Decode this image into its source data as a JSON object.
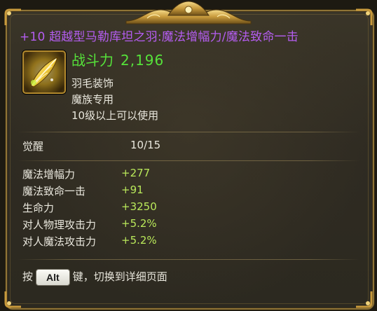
{
  "tooltip": {
    "title": "+10 超越型马勒库坦之羽:魔法增幅力/魔法致命一击",
    "combat_power_label": "战斗力",
    "combat_power_value": "2,196",
    "item_type": "羽毛装饰",
    "race_restriction": "魔族专用",
    "level_requirement": "10级以上可以使用",
    "awakening": {
      "label": "觉醒",
      "value": "10/15"
    },
    "stats": [
      {
        "name": "魔法增幅力",
        "value": "+277"
      },
      {
        "name": "魔法致命一击",
        "value": "+91"
      },
      {
        "name": "生命力",
        "value": "+3250"
      },
      {
        "name": "对人物理攻击力",
        "value": "+5.2%"
      },
      {
        "name": "对人魔法攻击力",
        "value": "+5.2%"
      }
    ],
    "footer": {
      "prefix": "按",
      "key_label": "Alt",
      "suffix": "键，切换到详细页面"
    },
    "item_icon": "golden-feather-icon"
  },
  "colors": {
    "title": "#b45df0",
    "combat_power": "#56e23a",
    "stat_value": "#b9e85a",
    "frame_gold": "#8f7436"
  }
}
